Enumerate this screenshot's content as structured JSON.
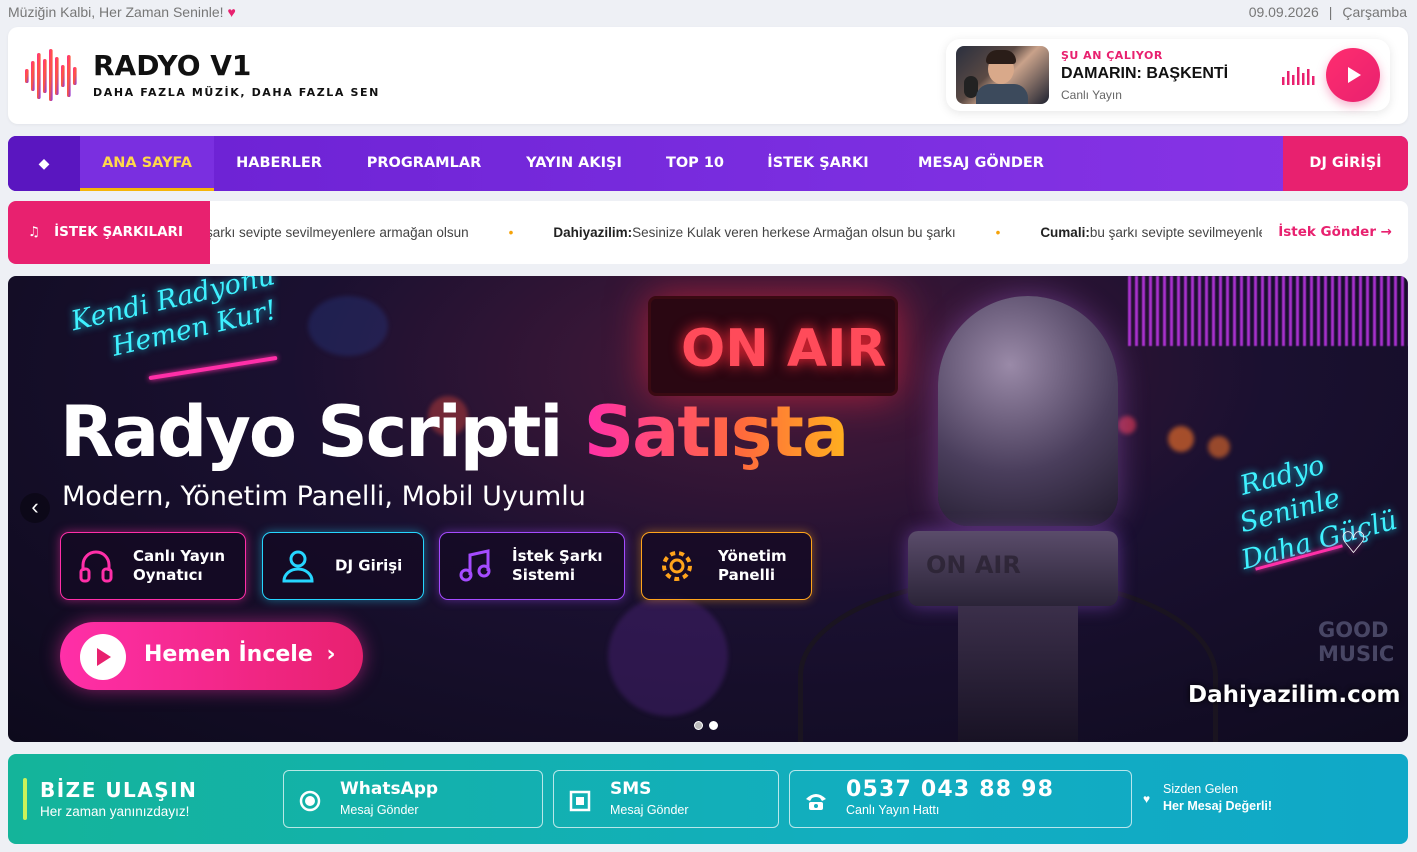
{
  "top": {
    "tagline": "Müziğin Kalbi, Her Zaman Seninle!",
    "heart": "♥",
    "date": "09.09.2026",
    "separator": "|",
    "day": "Çarşamba"
  },
  "brand": {
    "name": "RADYO V1",
    "slogan": "DAHA FAZLA MÜZİK, DAHA FAZLA SEN",
    "colors": [
      "#e8216f",
      "#8a34e6"
    ]
  },
  "now_playing": {
    "label": "ŞU AN ÇALIYOR",
    "title": "DAMARIN: BAŞKENTİ",
    "subtitle": "Canlı Yayın",
    "icon": "play-icon"
  },
  "nav": {
    "home_icon": "◆",
    "items": [
      "ANA SAYFA",
      "HABERLER",
      "PROGRAMLAR",
      "YAYIN AKIŞI",
      "TOP 10",
      "İSTEK ŞARKI",
      "MESAJ GÖNDER"
    ],
    "active": "ANA SAYFA",
    "dj": "DJ GİRİŞİ"
  },
  "ticker": {
    "badge": "İSTEK ŞARKILARI",
    "note_icon": "♫",
    "messages": [
      {
        "name": "",
        "text": "şarkı sevipte sevilmeyenlere armağan olsun"
      },
      {
        "name": "Dahiyazilim:",
        "text": "Sesinize Kulak veren herkese Armağan olsun bu şarkı"
      },
      {
        "name": "Cumali:",
        "text": "bu şarkı sevipte sevilmeyenlere"
      }
    ],
    "bullet": "•",
    "send": "İstek Gönder →"
  },
  "hero": {
    "script_top_1": "Kendi Radyonu",
    "script_top_2": "Hemen Kur!",
    "title_white": "Radyo Scripti ",
    "title_pink": "Satışta",
    "subtitle": "Modern, Yönetim Panelli, Mobil Uyumlu",
    "features": [
      {
        "line1": "Canlı Yayın",
        "line2": "Oynatıcı",
        "icon": "headphones-icon",
        "color": "#ff2fa8"
      },
      {
        "line1": "DJ Girişi",
        "line2": "",
        "icon": "user-icon",
        "color": "#26d6ff"
      },
      {
        "line1": "İstek Şarkı",
        "line2": "Sistemi",
        "icon": "music-note-icon",
        "color": "#a54bff"
      },
      {
        "line1": "Yönetim",
        "line2": "Panelli",
        "icon": "gear-icon",
        "color": "#ffa41b"
      }
    ],
    "cta": "Hemen İncele",
    "cta_chevron": "›",
    "on_air": "ON AIR",
    "mic_band": "ON AIR",
    "script_right_1": "Radyo",
    "script_right_2": "Seninle",
    "script_right_3": "Daha Güçlü",
    "heart": "♡",
    "good_music_1": "GOOD",
    "good_music_2": "MUSIC",
    "domain": "Dahiyazilim.com",
    "prev": "‹",
    "slides": 2,
    "active_slide": 2
  },
  "contact": {
    "title": "BİZE ULAŞIN",
    "subtitle": "Her zaman yanınızdayız!",
    "whatsapp_title": "WhatsApp",
    "whatsapp_sub": "Mesaj Gönder",
    "sms_title": "SMS",
    "sms_sub": "Mesaj Gönder",
    "phone": "0537 043 88 98",
    "phone_sub": "Canlı Yayın Hattı",
    "note_heart": "♥",
    "note_line1": "Sizden Gelen",
    "note_line2": "Her Mesaj Değerli!"
  }
}
